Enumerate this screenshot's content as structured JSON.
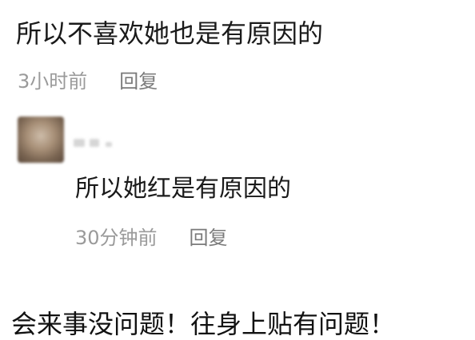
{
  "comment": {
    "text": "所以不喜欢她也是有原因的",
    "time": "3小时前",
    "reply_label": "回复"
  },
  "reply": {
    "text": "所以她红是有原因的",
    "time": "30分钟前",
    "reply_label": "回复"
  },
  "caption": "会来事没问题！往身上贴有问题！"
}
